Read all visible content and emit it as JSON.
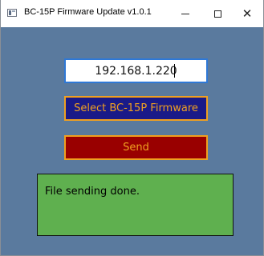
{
  "window": {
    "title": "BC-15P Firmware Update v1.0.1",
    "controls": {
      "minimize": "minimize-icon",
      "maximize": "maximize-icon",
      "close": "close-icon"
    }
  },
  "form": {
    "ip_address": "192.168.1.220",
    "select_firmware_label": "Select BC-15P Firmware",
    "send_label": "Send",
    "status_text": "File sending done."
  },
  "colors": {
    "background": "#5a7a9e",
    "select_button_bg": "#1a1a88",
    "send_button_bg": "#990000",
    "button_text": "#f0a020",
    "status_bg": "#5fb04f",
    "input_border": "#2e78d6"
  }
}
